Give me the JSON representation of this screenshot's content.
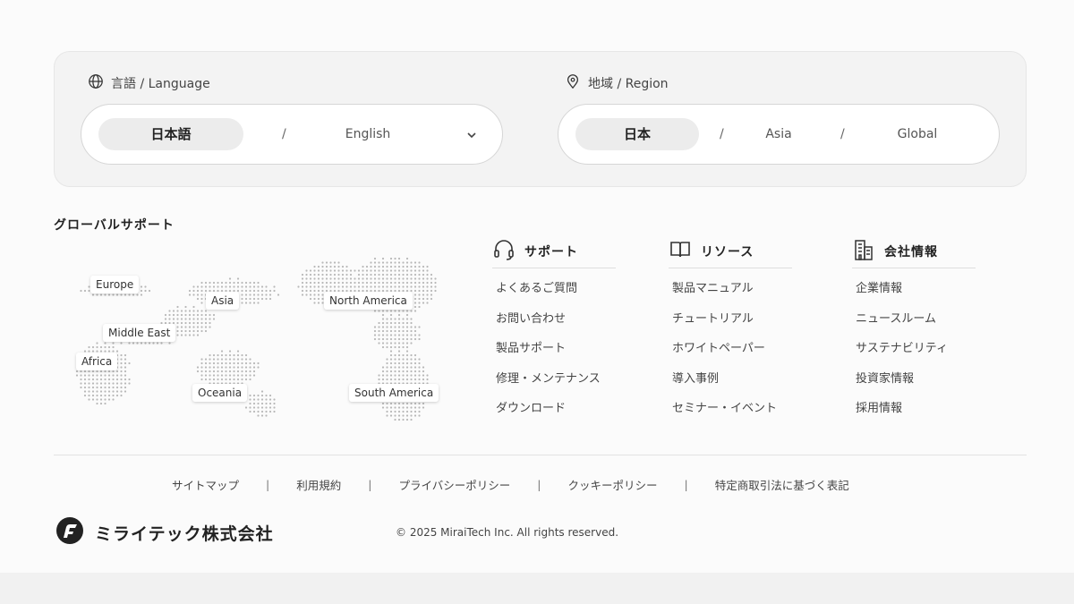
{
  "language_selector": {
    "label": "言語 / Language",
    "options": [
      "日本語",
      "English"
    ],
    "separator": "/",
    "selected": "日本語"
  },
  "region_selector": {
    "label": "地域 / Region",
    "options": [
      "日本",
      "Asia",
      "Global"
    ],
    "separator": "/",
    "selected": "日本"
  },
  "global_support": {
    "title": "グローバルサポート",
    "regions": [
      "Europe",
      "Asia",
      "North America",
      "Middle East",
      "Africa",
      "Oceania",
      "South America"
    ]
  },
  "columns": [
    {
      "title": "サポート",
      "icon": "headset-icon",
      "links": [
        "よくあるご質問",
        "お問い合わせ",
        "製品サポート",
        "修理・メンテナンス",
        "ダウンロード"
      ]
    },
    {
      "title": "リソース",
      "icon": "book-icon",
      "links": [
        "製品マニュアル",
        "チュートリアル",
        "ホワイトペーパー",
        "導入事例",
        "セミナー・イベント"
      ]
    },
    {
      "title": "会社情報",
      "icon": "building-icon",
      "links": [
        "企業情報",
        "ニュースルーム",
        "サステナビリティ",
        "投資家情報",
        "採用情報"
      ]
    }
  ],
  "legal_links": [
    "サイトマップ",
    "利用規約",
    "プライバシーポリシー",
    "クッキーポリシー",
    "特定商取引法に基づく表記"
  ],
  "legal_separator": "|",
  "brand": {
    "name": "ミライテック株式会社"
  },
  "copyright": "© 2025 MiraiTech Inc. All rights reserved.",
  "colors": {
    "background": "#fbfbfb",
    "panel": "#f3f3f3",
    "active_option": "#ececec",
    "text": "#333333"
  }
}
